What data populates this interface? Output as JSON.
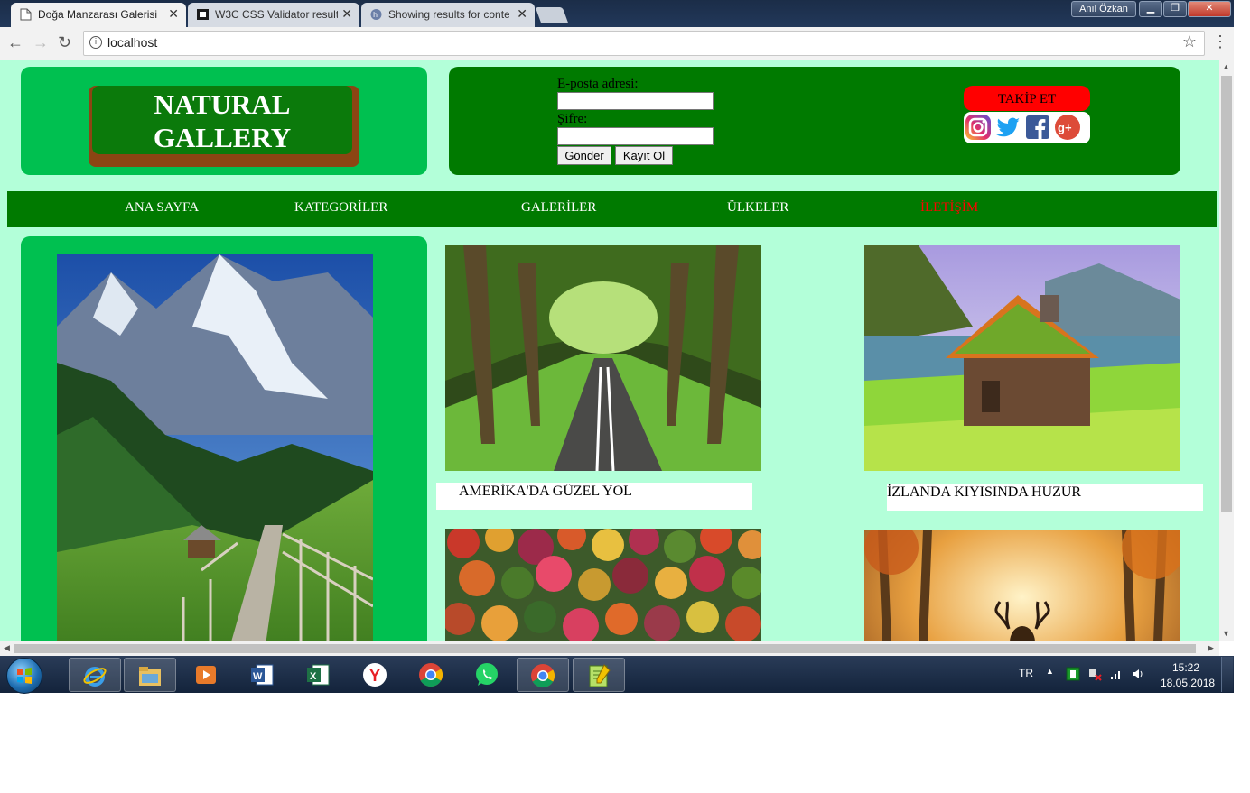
{
  "browser": {
    "tabs": [
      {
        "title": "Doğa Manzarası Galerisi",
        "active": true
      },
      {
        "title": "W3C CSS Validator result",
        "active": false
      },
      {
        "title": "Showing results for conte",
        "active": false
      }
    ],
    "user": "Anıl Özkan",
    "url": "localhost"
  },
  "site": {
    "logo_line1": "NATURAL",
    "logo_line2": "GALLERY",
    "form": {
      "email_label": "E-posta adresi:",
      "password_label": "Şifre:",
      "submit_label": "Gönder",
      "register_label": "Kayıt Ol"
    },
    "follow_label": "TAKİP ET",
    "social": [
      "instagram-icon",
      "twitter-icon",
      "facebook-icon",
      "google-plus-icon"
    ],
    "nav": [
      {
        "label": "ANA SAYFA",
        "active": false
      },
      {
        "label": "KATEGORİLER",
        "active": false
      },
      {
        "label": "GALERİLER",
        "active": false
      },
      {
        "label": "ÜLKELER",
        "active": false
      },
      {
        "label": "İLETİŞİM",
        "active": true
      }
    ],
    "gallery": [
      {
        "caption": "AMERİKA'DA GÜZEL YOL"
      },
      {
        "caption": "İZLANDA KIYISINDA HUZUR"
      }
    ],
    "colors": {
      "background": "#b3ffd9",
      "panel_green": "#00c050",
      "dark_green": "#007a00",
      "logo_brown": "#8b4513",
      "follow_red": "#ff0000"
    }
  },
  "taskbar": {
    "language": "TR",
    "time": "15:22",
    "date": "18.05.2018",
    "apps": [
      "internet-explorer-icon",
      "file-explorer-icon",
      "media-player-icon",
      "word-icon",
      "excel-icon",
      "yandex-icon",
      "chrome-icon",
      "whatsapp-icon",
      "chrome-icon",
      "notepad-plus-icon"
    ]
  }
}
